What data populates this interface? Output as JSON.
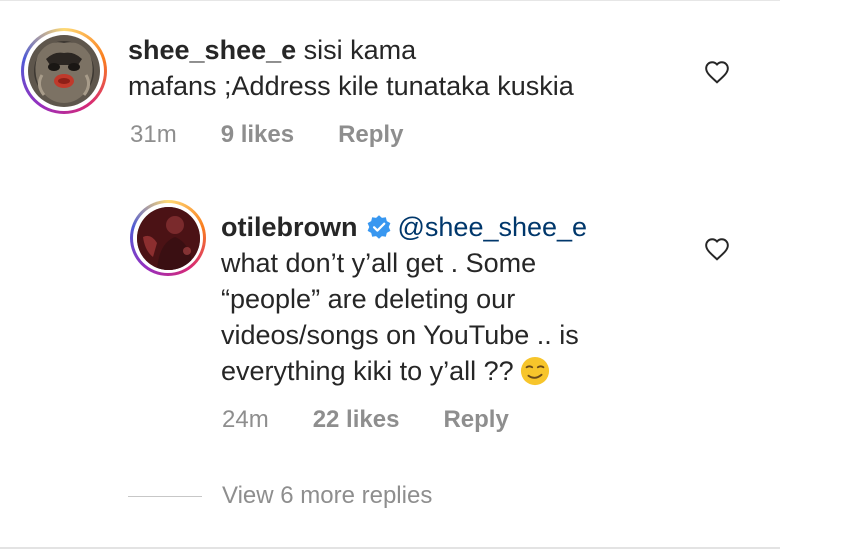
{
  "comment1": {
    "username": "shee_shee_e",
    "text_line1": "sisi kama",
    "text_line2": "mafans ;Address kile tunataka kuskia",
    "time": "31m",
    "likes": "9 likes",
    "reply": "Reply"
  },
  "comment2": {
    "username": "otilebrown",
    "mention": "@shee_shee_e",
    "text_line1": "what don’t y’all get . Some",
    "text_line2": "“people” are deleting our",
    "text_line3": "videos/songs on YouTube .. is",
    "text_line4": "everything kiki to y’all ??",
    "time": "24m",
    "likes": "22 likes",
    "reply": "Reply"
  },
  "view_more": "View 6 more replies",
  "icons": {
    "like": "heart-outline-icon",
    "verified": "verified-badge-icon",
    "emoji": "smirking-face-emoji"
  },
  "colors": {
    "text": "#262626",
    "meta": "#8e8e8e",
    "mention": "#00376b",
    "verified": "#3897f0",
    "emoji": "#f7c52b"
  }
}
